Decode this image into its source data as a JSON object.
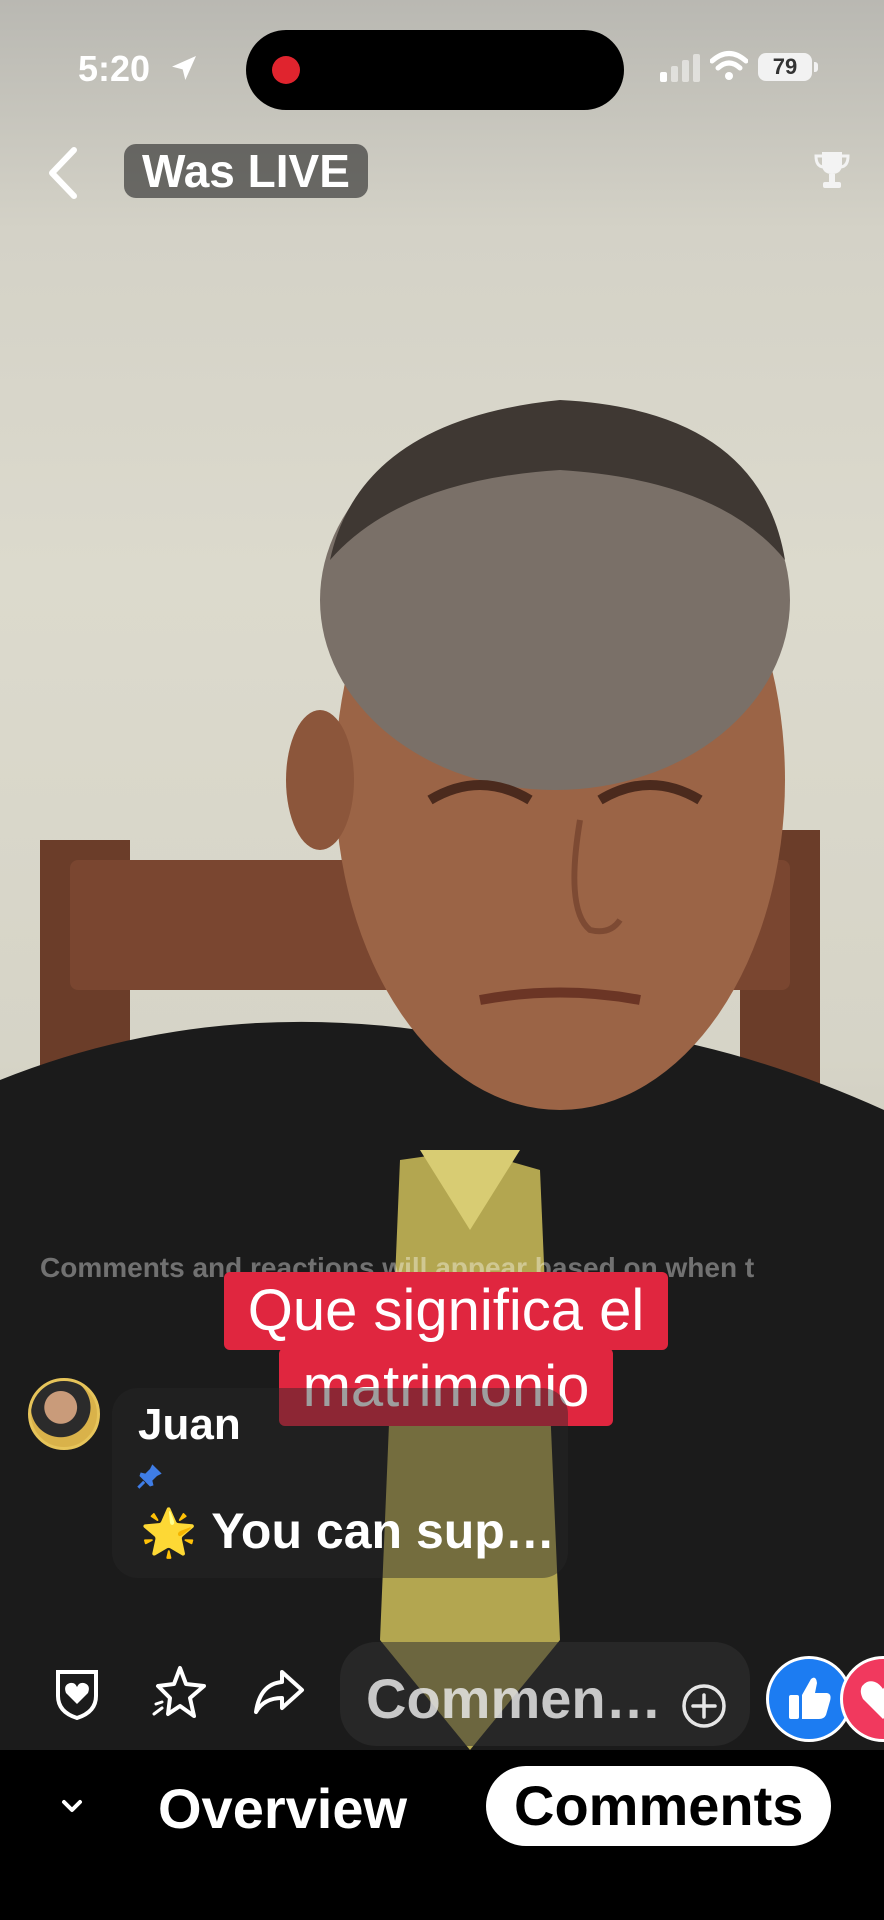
{
  "status_bar": {
    "time": "5:20",
    "battery": "79",
    "icons": [
      "location-arrow-icon",
      "signal-icon",
      "wifi-icon",
      "battery-icon"
    ]
  },
  "header": {
    "badge": "Was LIVE",
    "icons": [
      "back-chevron-icon",
      "trophy-icon"
    ]
  },
  "overlay": {
    "notice": "Comments and reactions will appear based on when t",
    "caption_line1": "Que significa el",
    "caption_line2": "matrimonio"
  },
  "pinned_comment": {
    "author": "Juan",
    "text": "You can sup…",
    "star": "🌟"
  },
  "actions": {
    "comment_placeholder": "Commen…",
    "icons": [
      "shield-heart-icon",
      "sparkle-star-icon",
      "share-arrow-icon",
      "add-circle-icon",
      "like-icon",
      "love-icon"
    ]
  },
  "tabs": {
    "overview": "Overview",
    "comments": "Comments",
    "active": "Comments"
  },
  "colors": {
    "caption_bg": "#e0263f",
    "like_blue": "#1c7cf2",
    "love_pink": "#f1395e",
    "recording_red": "#e0242e"
  }
}
